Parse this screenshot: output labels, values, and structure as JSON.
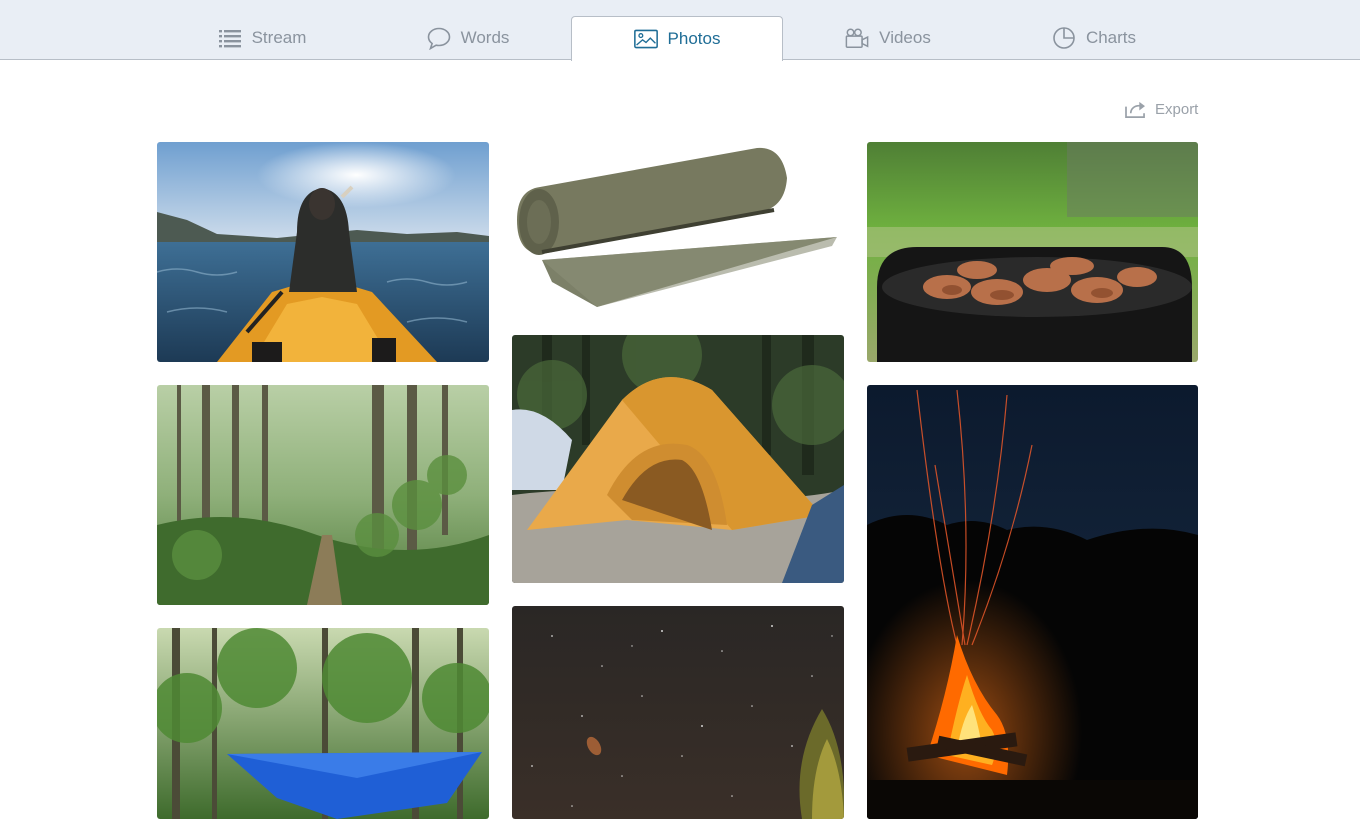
{
  "tabs": [
    {
      "label": "Stream",
      "icon": "list-icon",
      "active": false
    },
    {
      "label": "Words",
      "icon": "speech-bubble-icon",
      "active": false
    },
    {
      "label": "Photos",
      "icon": "image-icon",
      "active": true
    },
    {
      "label": "Videos",
      "icon": "video-camera-icon",
      "active": false
    },
    {
      "label": "Charts",
      "icon": "pie-chart-icon",
      "active": false
    }
  ],
  "toolbar": {
    "export_label": "Export"
  },
  "colors": {
    "tab_bar_bg": "#e9eef5",
    "active_tab_text": "#1f6d96",
    "inactive_tab_text": "#8a939e",
    "border": "#b7bec7"
  },
  "photos": [
    {
      "name": "kayak",
      "subject": "person kayaking on lake"
    },
    {
      "name": "sleeping-pad",
      "subject": "rolled sleeping pad"
    },
    {
      "name": "grill",
      "subject": "meat on a charcoal grill"
    },
    {
      "name": "forest-trail",
      "subject": "misty forest trail"
    },
    {
      "name": "tent",
      "subject": "orange dome tent at campsite"
    },
    {
      "name": "campfire",
      "subject": "campfire at night"
    },
    {
      "name": "hammock-tarp",
      "subject": "blue tarp in forest"
    },
    {
      "name": "night-sky",
      "subject": "starry night sky"
    }
  ]
}
